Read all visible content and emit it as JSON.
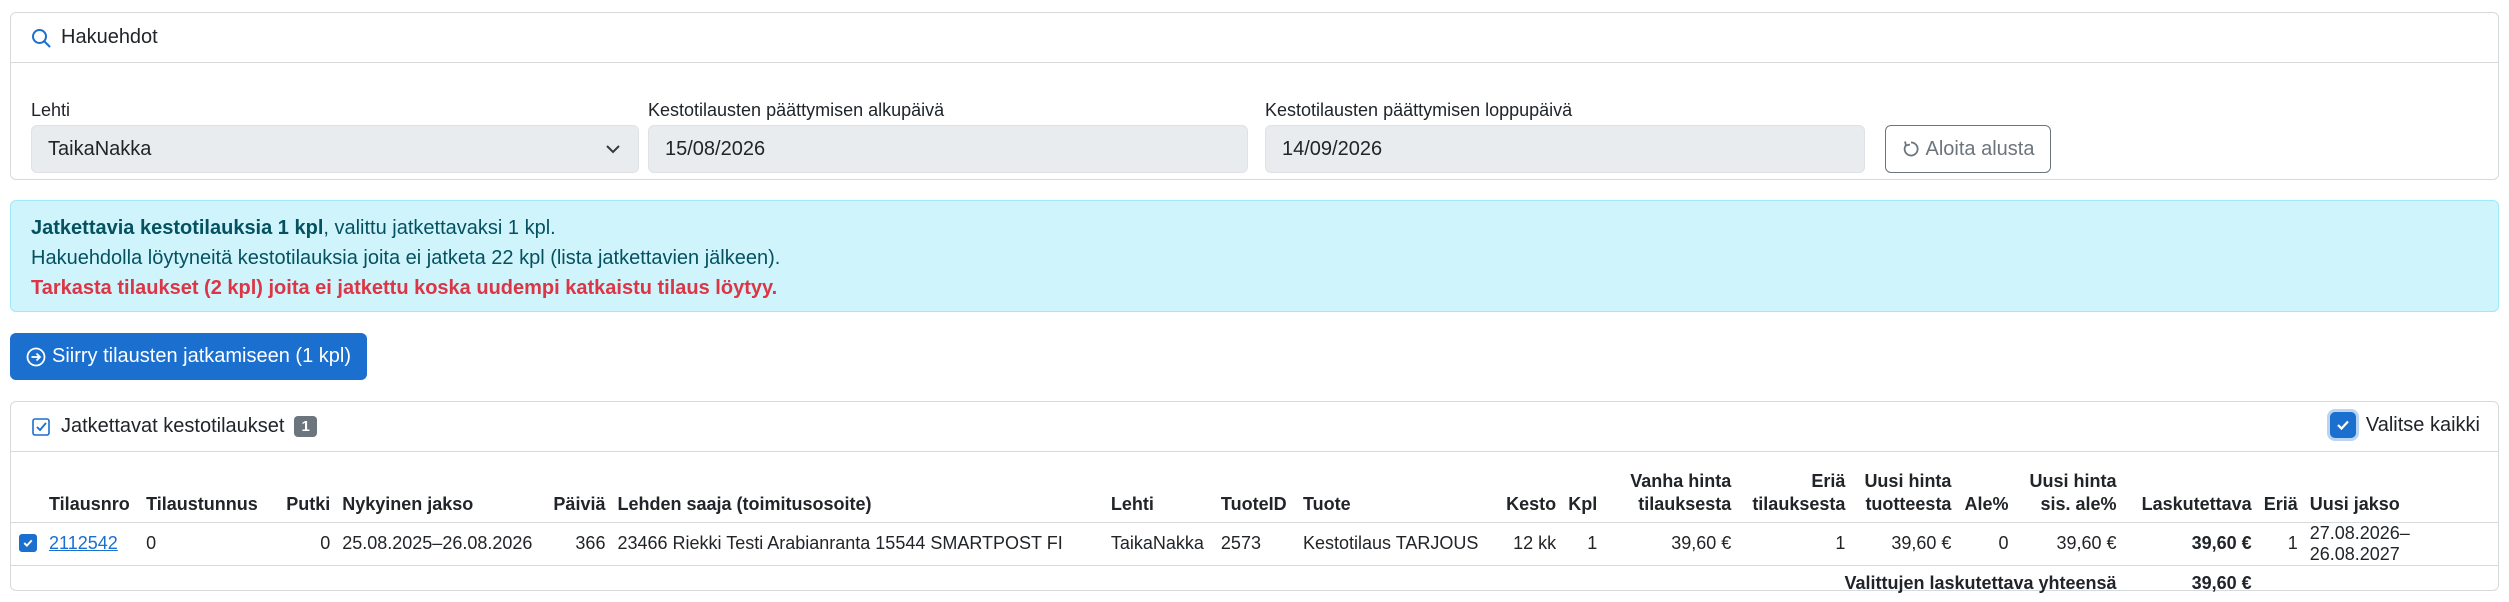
{
  "search": {
    "header_title": "Hakuehdot",
    "lehti_label": "Lehti",
    "lehti_value": "TaikaNakka",
    "start_label": "Kestotilausten päättymisen alkupäivä",
    "start_value": "15/08/2026",
    "end_label": "Kestotilausten päättymisen loppupäivä",
    "end_value": "14/09/2026",
    "reset_label": "Aloita alusta"
  },
  "alert": {
    "line1_bold": "Jatkettavia kestotilauksia 1 kpl",
    "line1_rest": ", valittu jatkettavaksi 1 kpl.",
    "line2": "Hakuehdolla löytyneitä kestotilauksia joita ei jatketa 22 kpl (lista jatkettavien jälkeen).",
    "line3": "Tarkasta tilaukset (2 kpl) joita ei jatkettu koska uudempi katkaistu tilaus löytyy."
  },
  "continue_button": "Siirry tilausten jatkamiseen (1 kpl)",
  "table_card": {
    "title": "Jatkettavat kestotilaukset",
    "badge": "1",
    "select_all": "Valitse kaikki",
    "columns": {
      "tilausnro": "Tilausnro",
      "tilaustunnus": "Tilaustunnus",
      "putki": "Putki",
      "jakso": "Nykyinen jakso",
      "paivia": "Päiviä",
      "saaja": "Lehden saaja (toimitusosoite)",
      "lehti": "Lehti",
      "tuoteid": "TuoteID",
      "tuote": "Tuote",
      "kesto": "Kesto",
      "kpl": "Kpl",
      "vanha1": "Vanha hinta",
      "vanha2": "tilauksesta",
      "eria1": "Eriä",
      "eria2": "tilauksesta",
      "uusi1": "Uusi hinta",
      "uusi2": "tuotteesta",
      "ale": "Ale%",
      "uusiale1": "Uusi hinta",
      "uusiale2": "sis. ale%",
      "laskutettava": "Laskutettava",
      "eria_new": "Eriä",
      "uusi_jakso": "Uusi jakso"
    },
    "row": {
      "tilausnro": "2112542",
      "tilaustunnus": "0",
      "putki": "0",
      "jakso": "25.08.2025–26.08.2026",
      "paivia": "366",
      "saaja": "23466 Riekki Testi Arabianranta 15544 SMARTPOST FI",
      "lehti": "TaikaNakka",
      "tuoteid": "2573",
      "tuote": "Kestotilaus TARJOUS",
      "kesto": "12 kk",
      "kpl": "1",
      "vanha": "39,60 €",
      "eria": "1",
      "uusi": "39,60 €",
      "ale": "0",
      "uusiale": "39,60 €",
      "laskutettava": "39,60 €",
      "eria_new": "1",
      "uusi_jakso": "27.08.2026–26.08.2027"
    },
    "total_label": "Valittujen laskutettava yhteensä",
    "total_value": "39,60 €"
  },
  "colors": {
    "primary": "#1a6fcf",
    "alert_bg": "#cff4fc",
    "alert_text": "#055160",
    "danger": "#dc3545"
  }
}
